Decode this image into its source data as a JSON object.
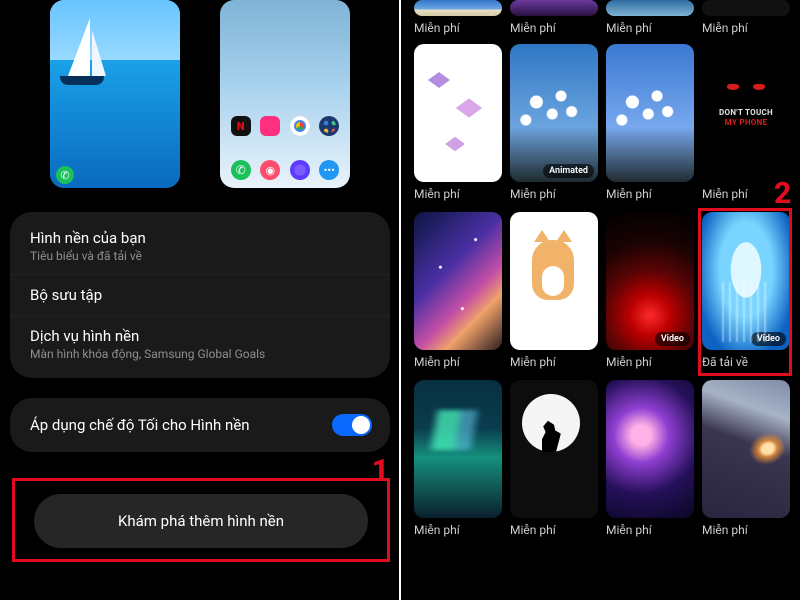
{
  "left": {
    "previews": {
      "lock_icon_name": "lock-preview",
      "home_icon_name": "home-preview"
    },
    "settings": {
      "your_wallpapers": {
        "title": "Hình nền của bạn",
        "subtitle": "Tiêu biểu và đã tải về"
      },
      "collection": {
        "title": "Bộ sưu tập"
      },
      "services": {
        "title": "Dịch vụ hình nền",
        "subtitle": "Màn hình khóa động, Samsung Global Goals"
      }
    },
    "dark_mode": {
      "label": "Áp dụng chế độ Tối cho Hình nền",
      "enabled": true
    },
    "explore_button": "Khám phá thêm hình nền",
    "callout_number": "1"
  },
  "right": {
    "callout_number": "2",
    "labels": {
      "free": "Miễn phí",
      "downloaded": "Đã tải về",
      "animated": "Animated",
      "video": "Video"
    },
    "dont_touch": {
      "line1": "DON'T TOUCH",
      "line2": "MY PHONE"
    },
    "row0": [
      {
        "caption_key": "free"
      },
      {
        "caption_key": "free"
      },
      {
        "caption_key": "free"
      },
      {
        "caption_key": "free"
      }
    ],
    "row1": [
      {
        "caption_key": "free",
        "art": "butter"
      },
      {
        "caption_key": "free",
        "art": "flower",
        "tag_key": "animated"
      },
      {
        "caption_key": "free",
        "art": "flower"
      },
      {
        "caption_key": "free",
        "art": "donttouch"
      }
    ],
    "row2": [
      {
        "caption_key": "free",
        "art": "galaxy"
      },
      {
        "caption_key": "free",
        "art": "cat"
      },
      {
        "caption_key": "free",
        "art": "redspark",
        "tag_key": "video"
      },
      {
        "caption_key": "downloaded",
        "art": "jelly",
        "tag_key": "video",
        "highlighted": true
      }
    ],
    "row3": [
      {
        "caption_key": "free",
        "art": "aurora"
      },
      {
        "caption_key": "free",
        "art": "wolf"
      },
      {
        "caption_key": "free",
        "art": "nebula"
      },
      {
        "caption_key": "free",
        "art": "galaxy2"
      }
    ]
  }
}
